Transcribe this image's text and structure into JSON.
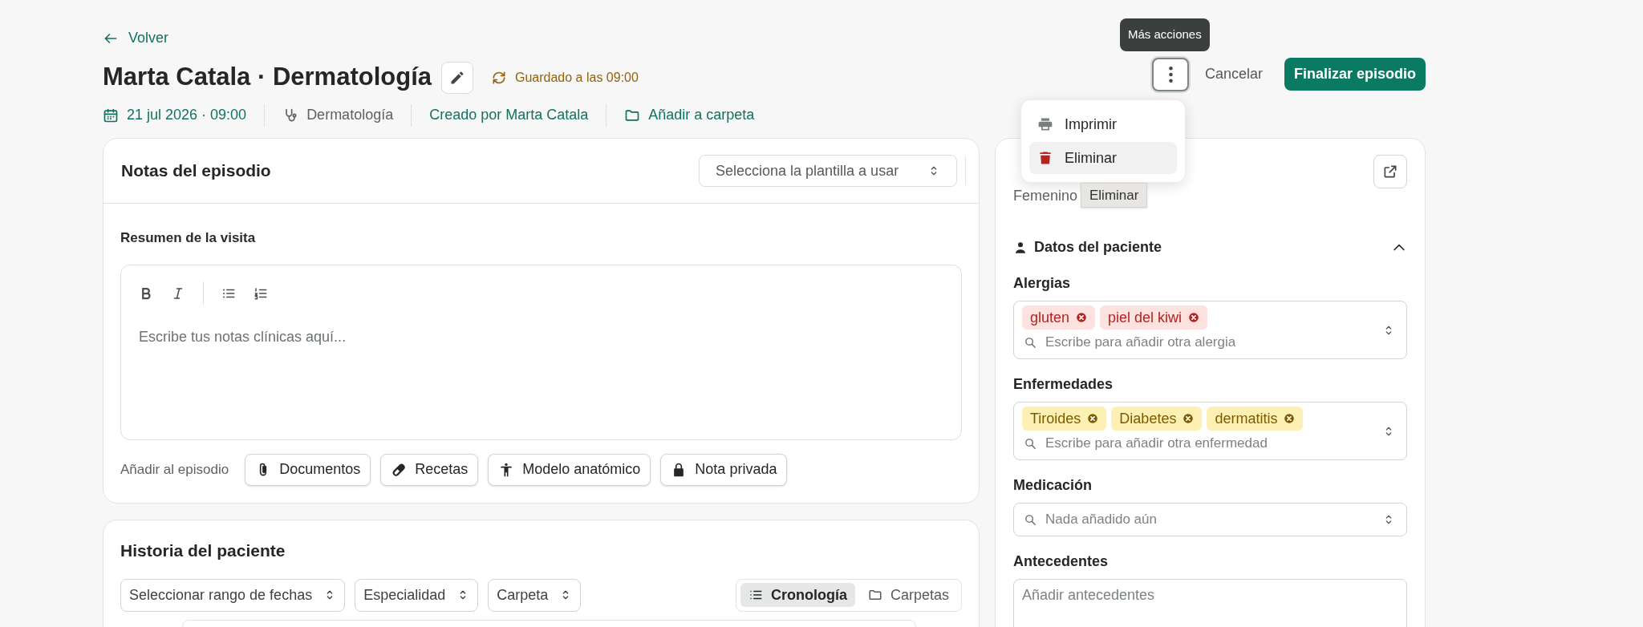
{
  "back_link": "Volver",
  "title": "Marta Catala · Dermatología",
  "save_status": "Guardado a las 09:00",
  "meta": [
    {
      "kind": "date",
      "text": "21 jul 2026 · 09:00"
    },
    {
      "kind": "specialty",
      "text": "Dermatología"
    },
    {
      "kind": "creator",
      "text": "Creado por Marta Catala"
    },
    {
      "kind": "folder",
      "text": "Añadir a carpeta"
    }
  ],
  "more_tooltip": "Más acciones",
  "cancel_button": "Cancelar",
  "finish_button": "Finalizar episodio",
  "more_menu": [
    {
      "kind": "print",
      "label": "Imprimir",
      "selected": false
    },
    {
      "kind": "delete",
      "label": "Eliminar",
      "selected": true
    }
  ],
  "hover_tooltip": "Eliminar",
  "notes": {
    "title": "Notas del episodio",
    "template_placeholder": "Selecciona la plantilla a usar",
    "section_label": "Resumen de la visita",
    "editor_placeholder": "Escribe tus notas clínicas aquí...",
    "add_label": "Añadir al episodio",
    "add_buttons": [
      {
        "kind": "documents",
        "label": "Documentos"
      },
      {
        "kind": "prescriptions",
        "label": "Recetas"
      },
      {
        "kind": "anatomy",
        "label": "Modelo anatómico"
      },
      {
        "kind": "private",
        "label": "Nota privada"
      }
    ]
  },
  "history": {
    "title": "Historia del paciente",
    "filters": [
      "Seleccionar rango de fechas",
      "Especialidad",
      "Carpeta"
    ],
    "views": [
      {
        "kind": "timeline",
        "label": "Cronología",
        "selected": true
      },
      {
        "kind": "folders",
        "label": "Carpetas",
        "selected": false
      }
    ]
  },
  "patient": {
    "gender": "Femenino",
    "section": "Datos del paciente",
    "expanded": true,
    "fields": [
      {
        "kind": "allergy",
        "label": "Alergias",
        "tags": [
          "gluten",
          "piel del kiwi"
        ],
        "placeholder": "Escribe para añadir otra alergia"
      },
      {
        "kind": "disease",
        "label": "Enfermedades",
        "tags": [
          "Tiroides",
          "Diabetes",
          "dermatitis"
        ],
        "placeholder": "Escribe para añadir otra enfermedad"
      },
      {
        "kind": "medication",
        "label": "Medicación",
        "placeholder": "Nada añadido aún"
      },
      {
        "kind": "text",
        "label": "Antecedentes",
        "placeholder": "Añadir antecedentes"
      }
    ]
  }
}
